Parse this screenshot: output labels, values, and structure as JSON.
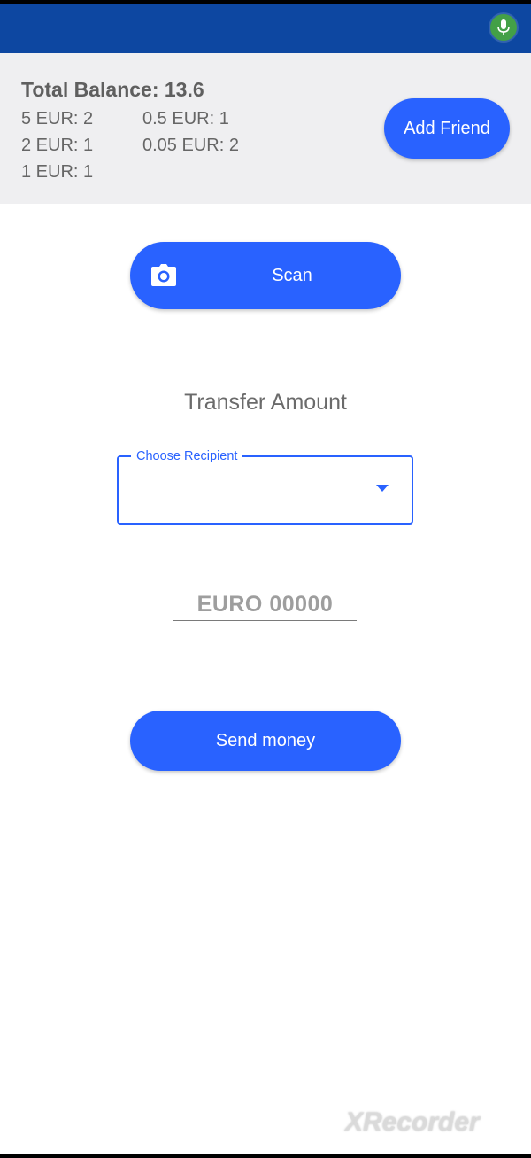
{
  "balance": {
    "total": "Total Balance: 13.6",
    "coins": [
      "5 EUR: 2",
      "0.5 EUR: 1",
      "2 EUR: 1",
      "0.05 EUR: 2",
      "1 EUR: 1"
    ]
  },
  "header": {
    "add_friend_label": "Add Friend",
    "mic_icon": "microphone-icon",
    "status_color": "#0d47a1"
  },
  "scan": {
    "label": "Scan",
    "icon": "camera-icon"
  },
  "transfer": {
    "title": "Transfer Amount",
    "recipient_label": "Choose Recipient",
    "recipient_value": "",
    "amount_placeholder": "EURO 00000",
    "send_label": "Send money"
  },
  "colors": {
    "accent": "#2962ff",
    "panel": "#efeff1"
  },
  "watermark": "XRecorder"
}
